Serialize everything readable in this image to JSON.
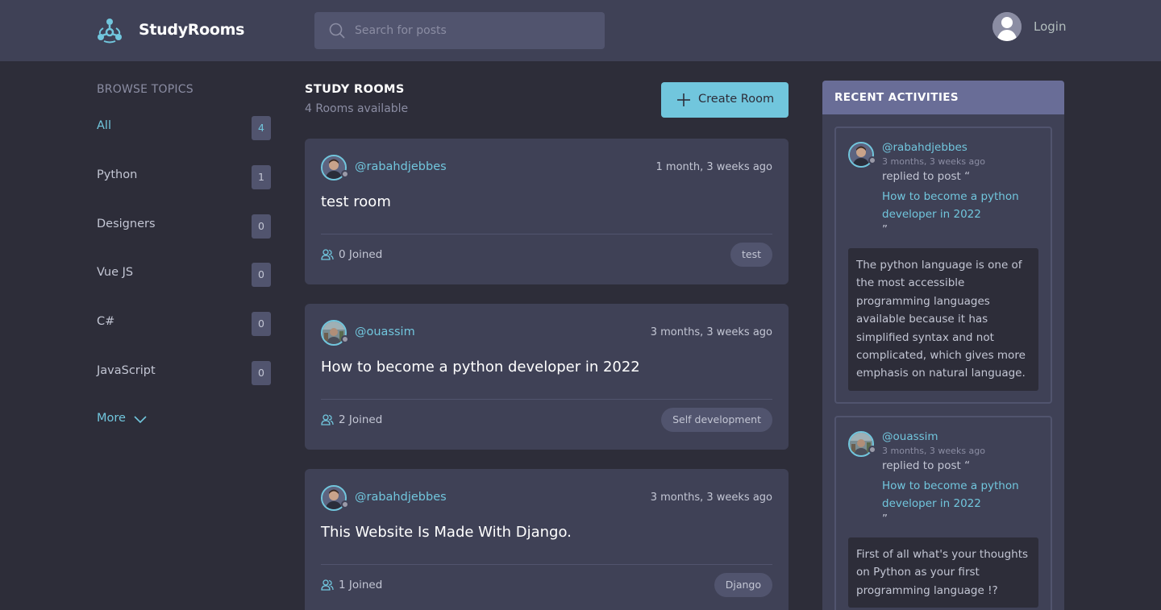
{
  "header": {
    "brand": "StudyRooms",
    "search_placeholder": "Search for posts",
    "login_label": "Login"
  },
  "sidebar": {
    "title": "BROWSE TOPICS",
    "topics": [
      {
        "label": "All",
        "count": "4"
      },
      {
        "label": "Python",
        "count": "1"
      },
      {
        "label": "Designers",
        "count": "0"
      },
      {
        "label": "Vue JS",
        "count": "0"
      },
      {
        "label": "C#",
        "count": "0"
      },
      {
        "label": "JavaScript",
        "count": "0"
      }
    ],
    "more_label": "More"
  },
  "main": {
    "title": "STUDY ROOMS",
    "subtitle": "4 Rooms available",
    "create_label": "Create Room",
    "rooms": [
      {
        "user": "@rabahdjebbes",
        "time": "1 month, 3 weeks ago",
        "title": "test room",
        "joined": "0 Joined",
        "topic": "test"
      },
      {
        "user": "@ouassim",
        "time": "3 months, 3 weeks ago",
        "title": "How to become a python developer in 2022",
        "joined": "2 Joined",
        "topic": "Self development"
      },
      {
        "user": "@rabahdjebbes",
        "time": "3 months, 3 weeks ago",
        "title": "This Website Is Made With Django.",
        "joined": "1 Joined",
        "topic": "Django"
      }
    ]
  },
  "activity": {
    "title": "RECENT ACTIVITIES",
    "items": [
      {
        "user": "@rabahdjebbes",
        "ago": "3 months, 3 weeks ago",
        "replied": "replied to post “",
        "post": "How to become a python developer in 2022",
        "close": "”",
        "message": "The python language is one of the most accessible programming languages available because it has simplified syntax and not complicated, which gives more emphasis on natural language."
      },
      {
        "user": "@ouassim",
        "ago": "3 months, 3 weeks ago",
        "replied": "replied to post “",
        "post": "How to become a python developer in 2022",
        "close": "”",
        "message": "First of all what's your thoughts on Python as your first programming language !?"
      }
    ]
  },
  "colors": {
    "background": "#2d2d39",
    "panel": "#3f4156",
    "accent": "#71c6dd",
    "activity_header": "#696d97"
  },
  "icons": [
    "logo-icon",
    "search-icon",
    "user-avatar-icon",
    "chevron-down-icon",
    "plus-icon",
    "users-icon"
  ]
}
